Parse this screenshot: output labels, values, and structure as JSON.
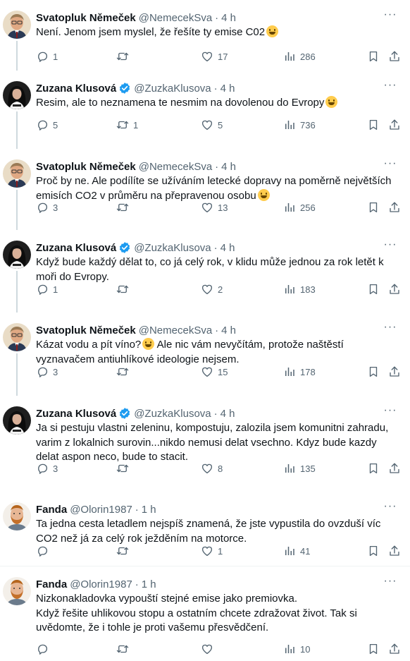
{
  "feed": {
    "tweets": [
      {
        "name": "Svatopluk Němeček",
        "handle": "@NemecekSva",
        "time": "4 h",
        "verified": false,
        "avatar": "man",
        "lines": [
          "Není. Jenom jsem myslel, že řešíte ty emise C02"
        ],
        "emoji_after_line": [
          0
        ],
        "stats": {
          "replies": "1",
          "retweets": "",
          "likes": "17",
          "views": "286"
        }
      },
      {
        "name": "Zuzana Klusová",
        "handle": "@ZuzkaKlusova",
        "time": "4 h",
        "verified": true,
        "avatar": "woman",
        "lines": [
          "Resim, ale to neznamena te nesmim na dovolenou do Evropy"
        ],
        "emoji_after_line": [
          0
        ],
        "stats": {
          "replies": "5",
          "retweets": "1",
          "likes": "5",
          "views": "736"
        }
      },
      {
        "name": "Svatopluk Němeček",
        "handle": "@NemecekSva",
        "time": "4 h",
        "verified": false,
        "avatar": "man",
        "lines": [
          "Proč by ne. Ale podílíte se užíváním letecké dopravy na poměrně největších",
          "emisích CO2 v průměru na přepravenou osobu"
        ],
        "emoji_after_line": [
          1
        ],
        "stats": {
          "replies": "3",
          "retweets": "",
          "likes": "13",
          "views": "256"
        }
      },
      {
        "name": "Zuzana Klusová",
        "handle": "@ZuzkaKlusova",
        "time": "4 h",
        "verified": true,
        "avatar": "woman",
        "lines": [
          "Když bude každý dělat to, co já celý rok, v klidu může jednou za rok letět k",
          "moři do Evropy."
        ],
        "emoji_after_line": [],
        "stats": {
          "replies": "1",
          "retweets": "",
          "likes": "2",
          "views": "183"
        }
      },
      {
        "name": "Svatopluk Němeček",
        "handle": "@NemecekSva",
        "time": "4 h",
        "verified": false,
        "avatar": "man",
        "lines": [
          "Kázat vodu a pít víno?",
          " Ale nic vám nevyčítám, protože naštěstí",
          "vyznavačem antiuhlíkové ideologie nejsem."
        ],
        "emoji_after_line": [
          0
        ],
        "inline_first_two": true,
        "stats": {
          "replies": "3",
          "retweets": "",
          "likes": "15",
          "views": "178"
        }
      },
      {
        "name": "Zuzana Klusová",
        "handle": "@ZuzkaKlusova",
        "time": "4 h",
        "verified": true,
        "avatar": "woman",
        "lines": [
          "Ja si pestuju vlastni zeleninu, kompostuju, zalozila jsem komunitni zahradu,",
          "varim z lokalnich surovin...nikdo nemusi delat vsechno. Kdyz bude kazdy",
          "delat aspon neco, bude to stacit."
        ],
        "emoji_after_line": [],
        "stats": {
          "replies": "3",
          "retweets": "",
          "likes": "8",
          "views": "135"
        }
      },
      {
        "name": "Fanda",
        "handle": "@Olorin1987",
        "time": "1 h",
        "verified": false,
        "avatar": "beard",
        "lines": [
          "Ta jedna cesta letadlem nejspíš znamená, že jste vypustila do ovzduší víc",
          "CO2 než já za celý rok ježděním na motorce."
        ],
        "emoji_after_line": [],
        "stats": {
          "replies": "",
          "retweets": "",
          "likes": "1",
          "views": "41"
        }
      },
      {
        "name": "Fanda",
        "handle": "@Olorin1987",
        "time": "1 h",
        "verified": false,
        "avatar": "beard",
        "lines": [
          "Nizkonakladovka vypouští stejné emise jako premiovka.",
          "Když řešite uhlikovou stopu a ostatním chcete zdražovat život. Tak si",
          "uvědomte, že i tohle je proti vašemu přesvědčení."
        ],
        "emoji_after_line": [],
        "stats": {
          "replies": "",
          "retweets": "",
          "likes": "",
          "views": "10"
        }
      }
    ]
  }
}
